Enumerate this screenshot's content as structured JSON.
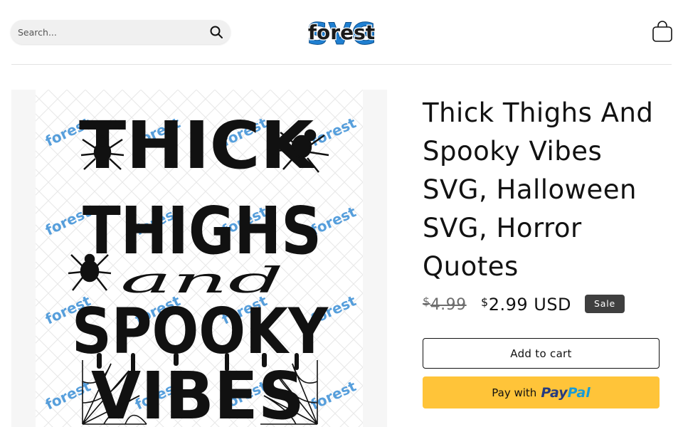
{
  "header": {
    "search": {
      "placeholder": "Search...",
      "icon": "search-icon"
    },
    "logo": {
      "text": "forest",
      "backdrop_text": "SVG",
      "colors": {
        "backdrop": "#1f7fd1",
        "text": "#1a1a1a"
      }
    },
    "cart": {
      "icon": "cart-icon"
    }
  },
  "product": {
    "image": {
      "lines": [
        "THICK",
        "THIGHS",
        "and",
        "SPOOKY",
        "VIBES"
      ],
      "watermark": "forest"
    },
    "title": "Thick Thighs And Spooky Vibes SVG, Halloween SVG, Horror Quotes",
    "price": {
      "currency_symbol": "$",
      "compare_at": "4.99",
      "sale_amount": "2.99 USD",
      "badge": "Sale"
    },
    "buttons": {
      "add_to_cart": "Add to cart",
      "paypal_prefix": "Pay with",
      "paypal_brand_a": "Pay",
      "paypal_brand_b": "Pal"
    }
  },
  "colors": {
    "text": "#121212",
    "muted": "#6e6e6e",
    "badge_bg": "#3f3f3f",
    "paypal_yellow": "#ffc439",
    "paypal_dark_blue": "#253b80",
    "paypal_light_blue": "#179bd7",
    "watermark_blue": "#1f7fd1"
  }
}
